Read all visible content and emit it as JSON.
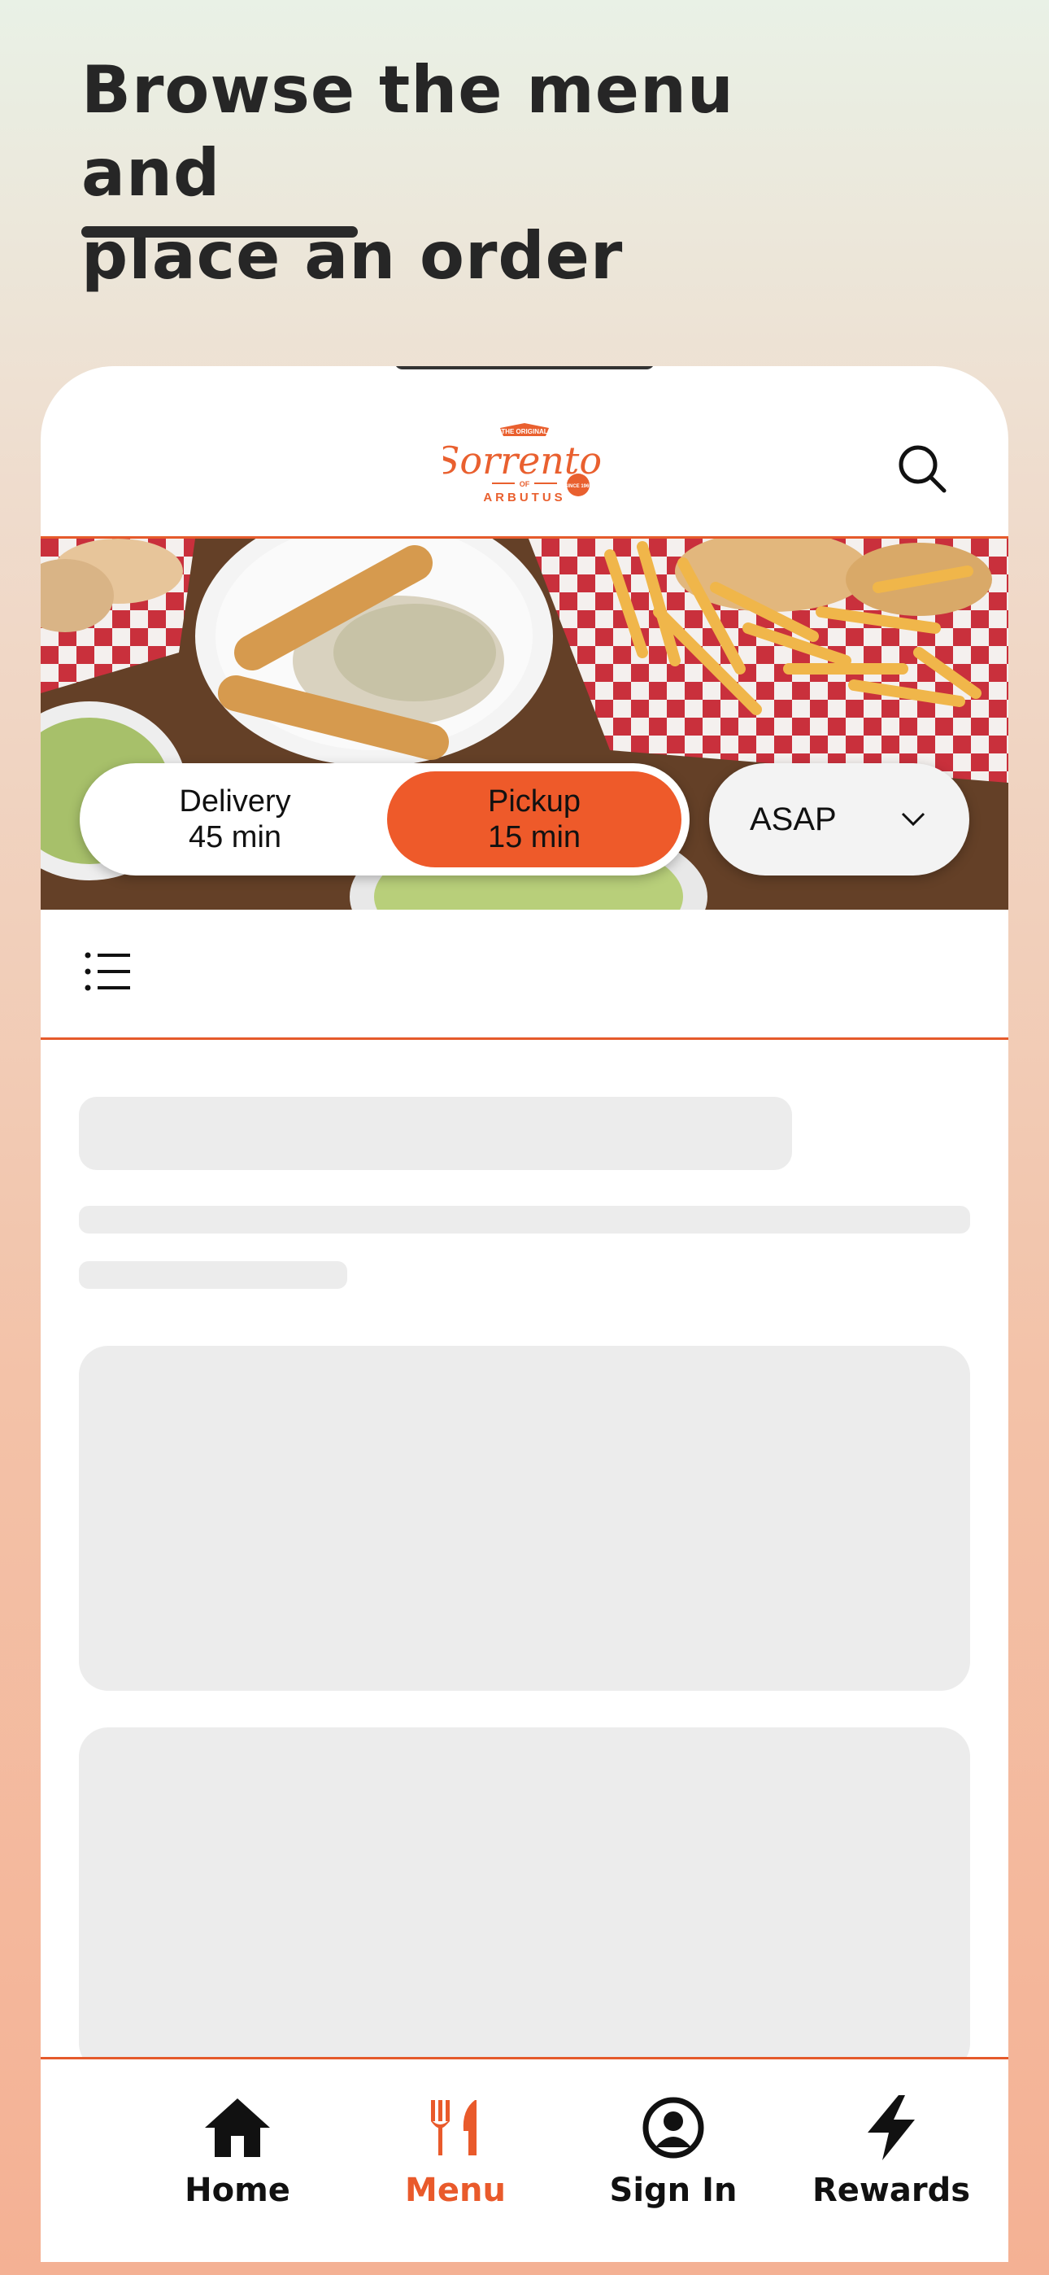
{
  "headline": {
    "line1": "Browse the menu and",
    "line2": "place an order"
  },
  "brand": {
    "logo_top": "THE ORIGINAL",
    "logo_script": "Sorrento",
    "logo_of": "OF",
    "logo_bottom": "ARBUTUS",
    "logo_since": "SINCE 1965",
    "accent_color": "#ee5a2a"
  },
  "header": {
    "search_icon": "search-icon"
  },
  "order_mode": {
    "delivery": {
      "label": "Delivery",
      "time": "45 min",
      "selected": false
    },
    "pickup": {
      "label": "Pickup",
      "time": "15 min",
      "selected": true
    }
  },
  "schedule": {
    "value": "ASAP",
    "icon": "chevron-down-icon"
  },
  "category_bar": {
    "icon": "list-icon"
  },
  "bottom_nav": {
    "items": [
      {
        "label": "Home",
        "icon": "home-icon",
        "active": false
      },
      {
        "label": "Menu",
        "icon": "fork-knife-icon",
        "active": true
      },
      {
        "label": "Sign In",
        "icon": "user-circle-icon",
        "active": false
      },
      {
        "label": "Rewards",
        "icon": "lightning-icon",
        "active": false
      }
    ]
  }
}
